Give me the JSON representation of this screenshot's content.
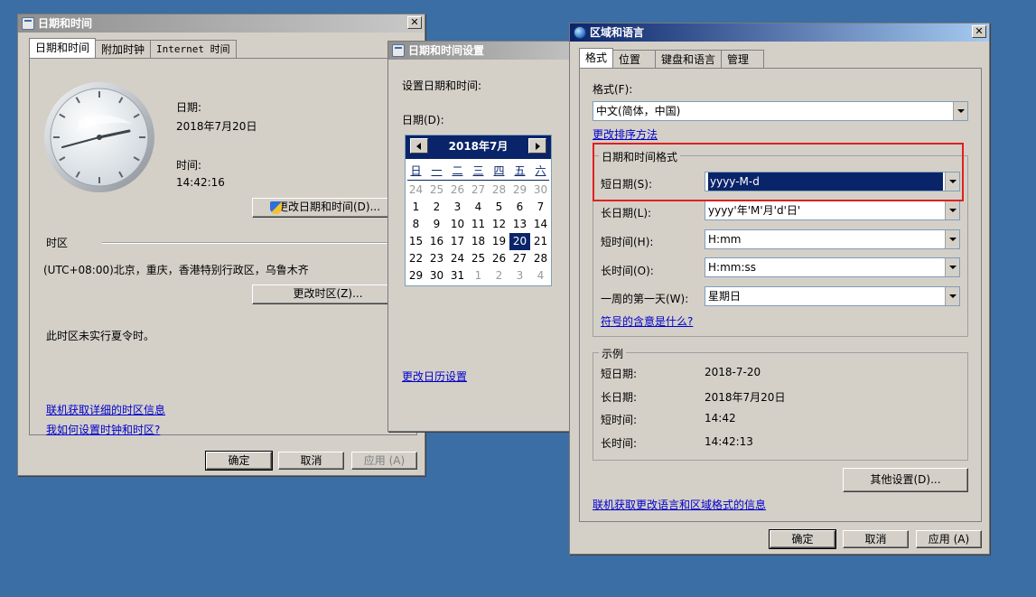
{
  "datetime_window": {
    "title": "日期和时间",
    "tabs": [
      "日期和时间",
      "附加时钟",
      "Internet 时间"
    ],
    "date_label": "日期:",
    "date_value": "2018年7月20日",
    "time_label": "时间:",
    "time_value": "14:42:16",
    "change_datetime_button": "更改日期和时间(D)...",
    "timezone_label": "时区",
    "timezone_value": "(UTC+08:00)北京，重庆，香港特别行政区，乌鲁木齐",
    "change_timezone_button": "更改时区(Z)...",
    "dst_note": "此时区未实行夏令时。",
    "link_tz_info": "联机获取详细的时区信息",
    "link_how_to": "我如何设置时钟和时区?",
    "ok": "确定",
    "cancel": "取消",
    "apply": "应用 (A)"
  },
  "datetime_settings": {
    "title": "日期和时间设置",
    "prompt": "设置日期和时间:",
    "date_label": "日期(D):",
    "month_title": "2018年7月",
    "weekdays": [
      "日",
      "一",
      "二",
      "三",
      "四",
      "五",
      "六"
    ],
    "days": [
      [
        "24",
        "25",
        "26",
        "27",
        "28",
        "29",
        "30"
      ],
      [
        "1",
        "2",
        "3",
        "4",
        "5",
        "6",
        "7"
      ],
      [
        "8",
        "9",
        "10",
        "11",
        "12",
        "13",
        "14"
      ],
      [
        "15",
        "16",
        "17",
        "18",
        "19",
        "20",
        "21"
      ],
      [
        "22",
        "23",
        "24",
        "25",
        "26",
        "27",
        "28"
      ],
      [
        "29",
        "30",
        "31",
        "1",
        "2",
        "3",
        "4"
      ]
    ],
    "selected_day": "20",
    "change_calendar_link": "更改日历设置"
  },
  "region_window": {
    "title": "区域和语言",
    "tabs": [
      "格式",
      "位置",
      "键盘和语言",
      "管理"
    ],
    "format_label": "格式(F):",
    "format_value": "中文(简体，中国)",
    "change_sort_link": "更改排序方法",
    "group_datetime": "日期和时间格式",
    "short_date_label": "短日期(S):",
    "short_date_value": "yyyy-M-d",
    "long_date_label": "长日期(L):",
    "long_date_value": "yyyy'年'M'月'd'日'",
    "short_time_label": "短时间(H):",
    "short_time_value": "H:mm",
    "long_time_label": "长时间(O):",
    "long_time_value": "H:mm:ss",
    "first_day_label": "一周的第一天(W):",
    "first_day_value": "星期日",
    "symbol_link": "符号的含意是什么?",
    "group_example": "示例",
    "ex_short_date_label": "短日期:",
    "ex_short_date_value": "2018-7-20",
    "ex_long_date_label": "长日期:",
    "ex_long_date_value": "2018年7月20日",
    "ex_short_time_label": "短时间:",
    "ex_short_time_value": "14:42",
    "ex_long_time_label": "长时间:",
    "ex_long_time_value": "14:42:13",
    "other_settings_button": "其他设置(D)...",
    "online_link": "联机获取更改语言和区域格式的信息",
    "ok": "确定",
    "cancel": "取消",
    "apply": "应用 (A)"
  },
  "colors": {
    "desktop": "#3a6ea5",
    "highlight": "#0a246a",
    "annotation": "#e02020"
  }
}
